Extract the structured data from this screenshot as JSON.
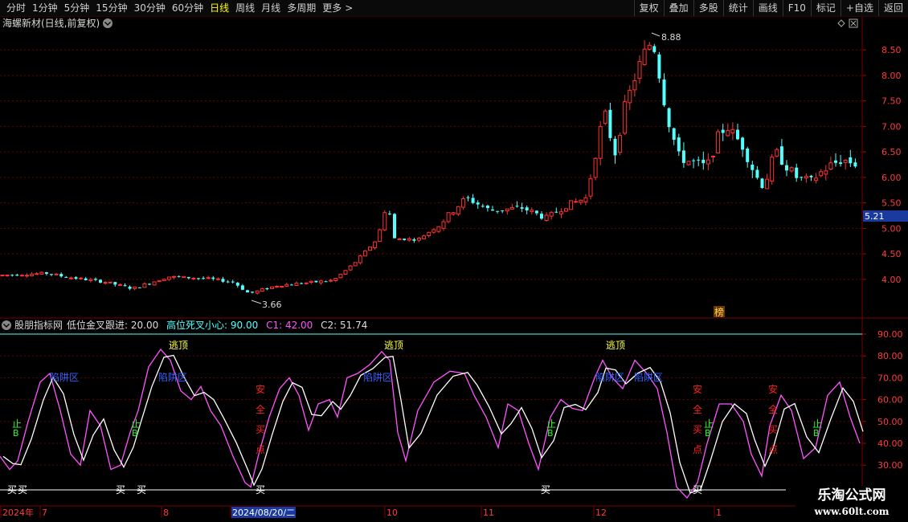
{
  "toolbar": {
    "periods": [
      {
        "label": "分时",
        "active": false
      },
      {
        "label": "1分钟",
        "active": false
      },
      {
        "label": "5分钟",
        "active": false
      },
      {
        "label": "15分钟",
        "active": false
      },
      {
        "label": "30分钟",
        "active": false
      },
      {
        "label": "60分钟",
        "active": false
      },
      {
        "label": "日线",
        "active": true
      },
      {
        "label": "周线",
        "active": false
      },
      {
        "label": "月线",
        "active": false
      },
      {
        "label": "多周期",
        "active": false
      },
      {
        "label": "更多",
        "active": false
      }
    ],
    "more_arrow": ">",
    "actions": [
      "复权",
      "叠加",
      "多股",
      "统计",
      "画线",
      "F10",
      "标记",
      "+自选",
      "返回"
    ]
  },
  "main_panel": {
    "title": "海螺新材(日线,前复权)",
    "price_labels": [
      "8.50",
      "8.00",
      "7.50",
      "7.00",
      "6.50",
      "6.00",
      "5.50",
      "5.00",
      "4.50",
      "4.00"
    ],
    "current_price": "5.21",
    "high_marker": "8.88",
    "low_marker": "3.66",
    "badge": "榜",
    "colors": {
      "up": "#ff3232",
      "down": "#54ffff",
      "grid": "#7a0000",
      "current_bg": "#1a3aa0"
    }
  },
  "indicator_panel": {
    "name": "股朋指标网",
    "params": [
      {
        "label": "低位金叉跟进: 20.00",
        "color": "#dcdcdc"
      },
      {
        "label": "高位死叉小心: 90.00",
        "color": "#54ffff"
      },
      {
        "label": "C1: 42.00",
        "color": "#ff54ff"
      },
      {
        "label": "C2: 51.74",
        "color": "#dcdcdc"
      }
    ],
    "axis_labels": [
      "90.00",
      "80.00",
      "70.00",
      "60.00",
      "50.00",
      "40.00",
      "30.00"
    ],
    "annotations": {
      "escape_top": "逃顶",
      "trap_zone": "陷阱区",
      "safe_chars": [
        "安",
        "全",
        "买",
        "点"
      ],
      "stop_chars": [
        "止",
        "B"
      ],
      "buy": "买"
    }
  },
  "date_axis": {
    "labels": [
      "2024年",
      "7",
      "8",
      "2024/08/20/二",
      "10",
      "11",
      "12",
      "1"
    ]
  },
  "watermark": {
    "title": "乐淘公式网",
    "url": "www.60lt.com"
  }
}
